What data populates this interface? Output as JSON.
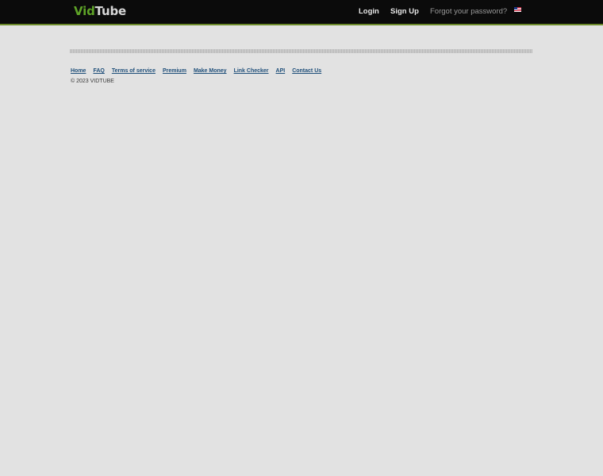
{
  "header": {
    "logo": {
      "part1": "Vid",
      "part2": "Tube"
    },
    "nav": {
      "login": "Login",
      "signup": "Sign Up",
      "forgot": "Forgot your password?"
    },
    "language_icon": "us-flag-icon"
  },
  "footer": {
    "links": [
      "Home",
      "FAQ",
      "Terms of service",
      "Premium",
      "Make Money",
      "Link Checker",
      "API",
      "Contact Us"
    ],
    "copyright": "© 2023 VIDTUBE"
  },
  "colors": {
    "background": "#e2e2e2",
    "topbar": "#0b0b0b",
    "accent": "#5ea327",
    "link": "#1f4f7a"
  }
}
